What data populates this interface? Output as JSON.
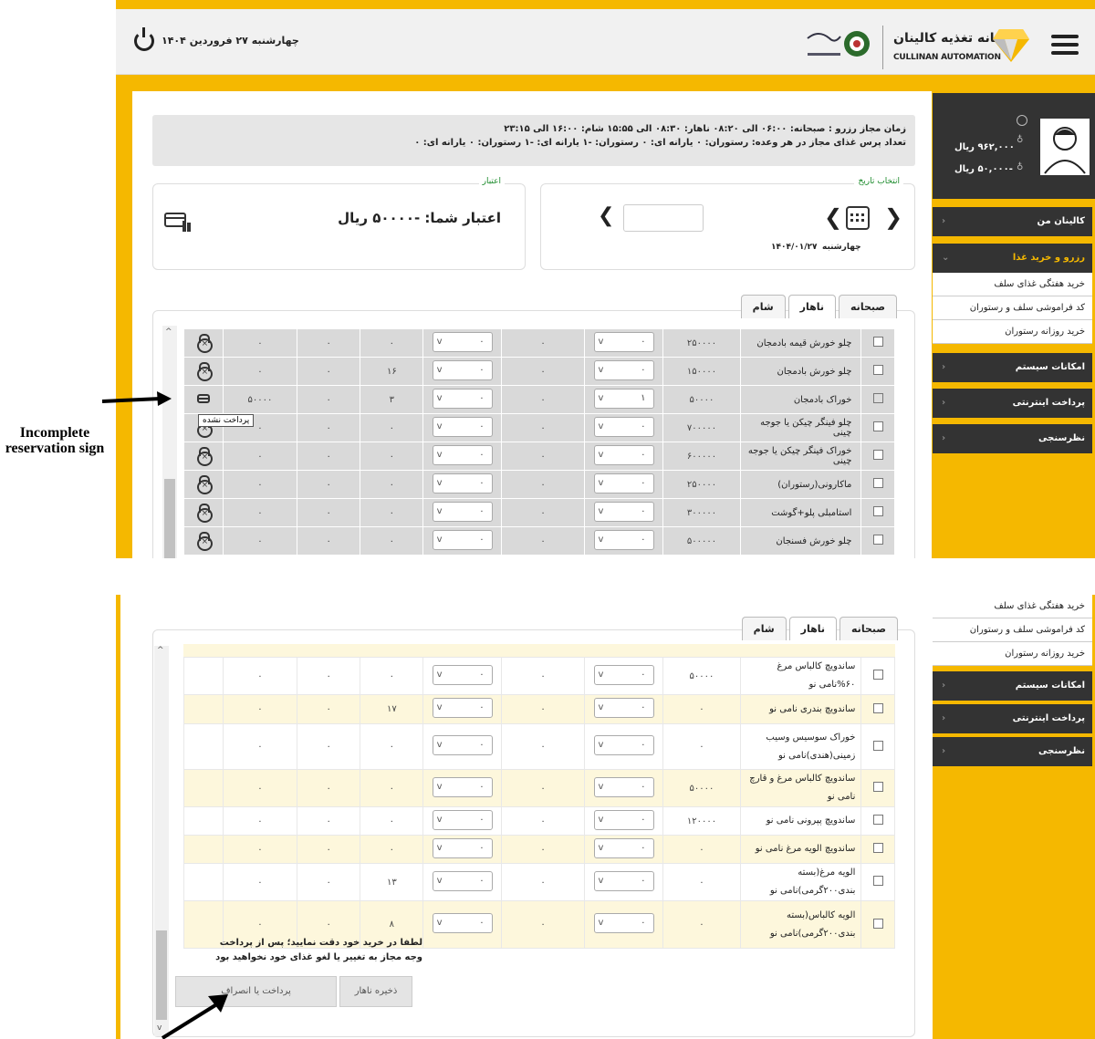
{
  "header": {
    "date": "چهارشنبه ۲۷ فروردین ۱۴۰۴",
    "brand_title": "سامانه تغذیه کالینان",
    "brand_sub": "CULLINAN AUTOMATION"
  },
  "info": {
    "line1": "زمان مجاز رزرو : صبحانه: ۰۶:۰۰ الی ۰۸:۲۰    ناهار: ۰۸:۳۰ الی ۱۵:۵۵    شام: ۱۶:۰۰ الی ۲۳:۱۵",
    "line2": "تعداد پرس غذای مجاز در هر وعده:    رستوران: ۰   یارانه ای: ۰    رستوران: -۱   یارانه ای: -۱    رستوران: ۰   یارانه ای: ۰"
  },
  "date_panel": {
    "legend": "انتخاب تاریخ",
    "day": "چهارشنبه",
    "date": "۱۴۰۴/۰۱/۲۷"
  },
  "credit_panel": {
    "legend": "اعتبار",
    "text": "اعتبار شما: -۵۰۰۰۰ ریال"
  },
  "tabs": [
    {
      "label": "صبحانه"
    },
    {
      "label": "ناهار"
    },
    {
      "label": "شام"
    }
  ],
  "profile": {
    "balance1": "۹۶۲,۰۰۰ ریال",
    "balance2": "-۵۰,۰۰۰ ریال"
  },
  "sidebar": {
    "my": "کالینان من",
    "reserve": "رزرو و خرید غذا",
    "sub1": "خرید هفتگی غذای سلف",
    "sub2": "کد فراموشی سلف و رستوران",
    "sub3": "خرید روزانه رستوران",
    "system": "امکانات سیستم",
    "pay": "پرداخت اینترنتی",
    "survey": "نظرسنجی"
  },
  "top_rows": [
    {
      "name": "چلو خورش قیمه بادمجان",
      "price": "۲۵۰۰۰۰",
      "q1": "۰",
      "q2": "۰",
      "c1": "۰",
      "c2": "۰",
      "c3": "۰",
      "c4": "۰",
      "checked": false,
      "icon": "lock"
    },
    {
      "name": "چلو خورش بادمجان",
      "price": "۱۵۰۰۰۰",
      "q1": "۰",
      "q2": "۰",
      "c1": "۰",
      "c2": "۱۶",
      "c3": "۰",
      "c4": "۰",
      "checked": false,
      "icon": "lock"
    },
    {
      "name": "خوراک بادمجان",
      "price": "۵۰۰۰۰",
      "q1": "۱",
      "q2": "۰",
      "c1": "۰",
      "c2": "۳",
      "c3": "۰",
      "c4": "۵۰۰۰۰",
      "checked": true,
      "icon": "card"
    },
    {
      "name": "چلو فینگر چیکن یا جوجه چینی",
      "price": "۷۰۰۰۰۰",
      "q1": "۰",
      "q2": "۰",
      "c1": "۰",
      "c2": "۰",
      "c3": "۰",
      "c4": "۰",
      "checked": false,
      "icon": "lock"
    },
    {
      "name": "خوراک فینگر چیکن یا جوجه چینی",
      "price": "۶۰۰۰۰۰",
      "q1": "۰",
      "q2": "۰",
      "c1": "۰",
      "c2": "۰",
      "c3": "۰",
      "c4": "۰",
      "checked": false,
      "icon": "lock"
    },
    {
      "name": "ماکارونی(رستوران)",
      "price": "۲۵۰۰۰۰",
      "q1": "۰",
      "q2": "۰",
      "c1": "۰",
      "c2": "۰",
      "c3": "۰",
      "c4": "۰",
      "checked": false,
      "icon": "lock"
    },
    {
      "name": "استامبلی پلو+گوشت",
      "price": "۳۰۰۰۰۰",
      "q1": "۰",
      "q2": "۰",
      "c1": "۰",
      "c2": "۰",
      "c3": "۰",
      "c4": "۰",
      "checked": false,
      "icon": "lock"
    },
    {
      "name": "چلو خورش فسنجان",
      "price": "۵۰۰۰۰۰",
      "q1": "۰",
      "q2": "۰",
      "c1": "۰",
      "c2": "۰",
      "c3": "۰",
      "c4": "۰",
      "checked": false,
      "icon": "lock"
    }
  ],
  "tooltip": "پرداخت نشده",
  "bottom_rows": [
    {
      "name": "ساندویچ کالباس مرغ ۶۰%نامی نو",
      "price": "۵۰۰۰۰",
      "c2": "۰",
      "h": 32
    },
    {
      "name": "ساندویچ بندری نامی نو",
      "price": "۰",
      "c2": "۱۷",
      "h": 32
    },
    {
      "name": "خوراک سوسیس وسیب زمینی(هندی)نامی نو",
      "price": "۰",
      "c2": "۰",
      "h": 50
    },
    {
      "name": "ساندویچ کالباس مرغ و قارچ نامی نو",
      "price": "۵۰۰۰۰",
      "c2": "۰",
      "h": 30
    },
    {
      "name": "ساندویچ پپرونی نامی نو",
      "price": "۱۲۰۰۰۰",
      "c2": "۰",
      "h": 30
    },
    {
      "name": "ساندویچ الویه مرغ نامی نو",
      "price": "۰",
      "c2": "۰",
      "h": 30
    },
    {
      "name": "الویه مرغ(بسته بندی۲۰۰گرمی)نامی نو",
      "price": "۰",
      "c2": "۱۳",
      "h": 30
    },
    {
      "name": "الویه کالباس(بسته بندی۲۰۰گرمی)نامی نو",
      "price": "۰",
      "c2": "۸",
      "h": 52
    }
  ],
  "note": "لطفا در خرید خود دقت نمایید؛ پس از پرداخت وجه مجاز به تغییر یا لغو غذای خود نخواهید بود",
  "buttons": {
    "pay": "پرداخت یا انصراف",
    "save": "ذخیره ناهار"
  },
  "annotation": "Incomplete reservation sign",
  "colors": {
    "accent": "#f5b800",
    "dark": "#333333",
    "row_gray": "#d9d9d9",
    "row_yellow": "#fdf7dc"
  }
}
